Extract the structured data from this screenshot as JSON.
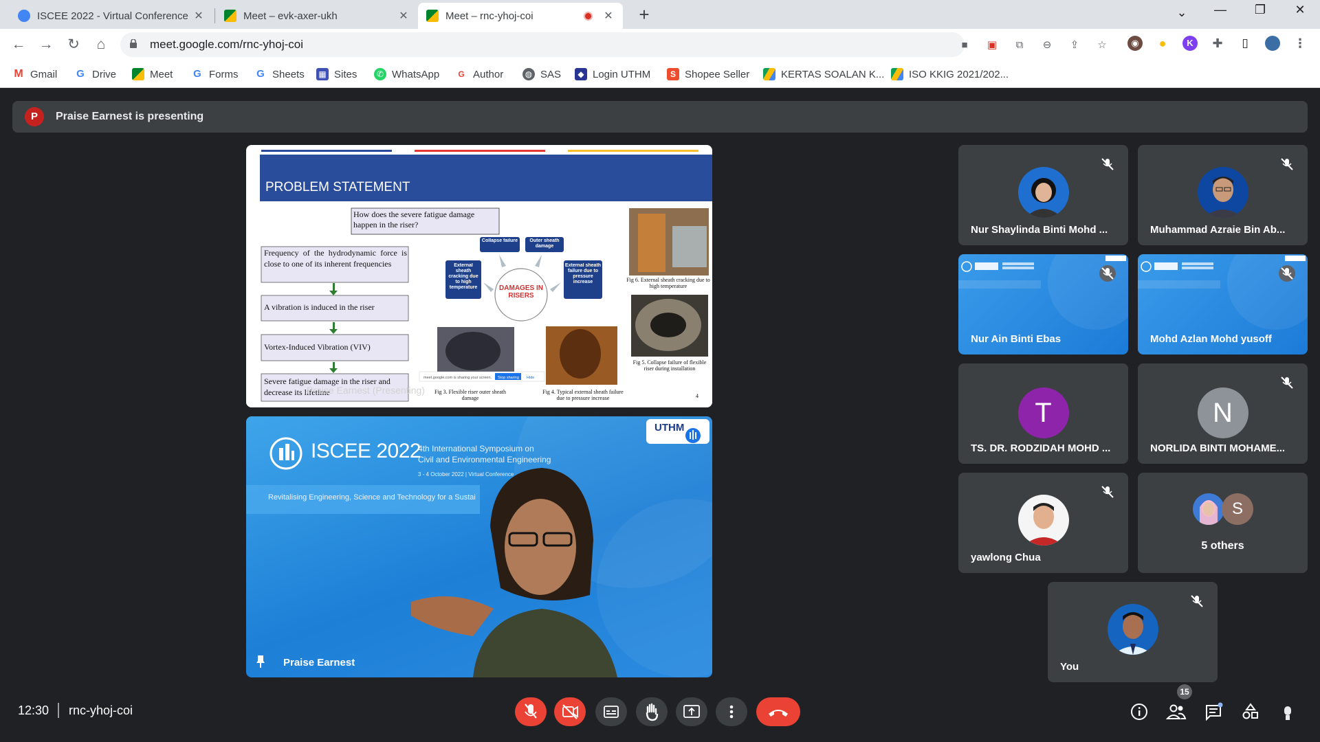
{
  "browser": {
    "tabs": [
      {
        "title": "ISCEE 2022 - Virtual Conference",
        "active": false
      },
      {
        "title": "Meet – evk-axer-ukh",
        "active": false
      },
      {
        "title": "Meet – rnc-yhoj-coi",
        "active": true
      }
    ],
    "url": "meet.google.com/rnc-yhoj-coi",
    "profile_initial": "K",
    "bookmarks": [
      "Gmail",
      "Drive",
      "Meet",
      "Forms",
      "Sheets",
      "Sites",
      "WhatsApp",
      "Author",
      "SAS",
      "Login UTHM",
      "Shopee Seller",
      "KERTAS SOALAN K...",
      "ISO KKIG 2021/202..."
    ]
  },
  "meet": {
    "presenter_initial": "P",
    "presenting_text": "Praise Earnest is presenting",
    "slide": {
      "title": "PROBLEM STATEMENT",
      "question": "How does the severe fatigue damage happen in the riser?",
      "steps": [
        "Frequency of the hydrodynamic force is close to one of its inherent frequencies",
        "A vibration is induced in the riser",
        "Vortex-Induced Vibration (VIV)",
        "Severe fatigue damage in the riser and decrease its lifetime"
      ],
      "center_label": "DAMAGES IN RISERS",
      "causes": [
        "Collapse failure",
        "Outer sheath damage",
        "External sheath cracking due to high temperature",
        "External sheath failure due to pressure increase"
      ],
      "captions": {
        "fig6": "Fig 6. External sheath cracking due to high temperature",
        "fig5": "Fig 5. Collapse failure of flexible riser during installation",
        "fig4": "Fig 4. Typical external sheath failure due to pressure increase",
        "fig3": "Fig 3. Flexible riser outer sheath damage"
      },
      "page_number": "4",
      "overlay_name": "Praise Earnest (Presenting)",
      "share_notice": "meet.google.com is sharing your screen.",
      "stop_sharing": "Stop sharing",
      "hide": "Hide"
    },
    "camera": {
      "brand": "ISCEE 2022",
      "symposium_line1": "4th International Symposium on",
      "symposium_line2": "Civil and Environmental Engineering",
      "dates": "3 - 4 October 2022  |  Virtual Conference",
      "tagline": "Revitalising Engineering, Science and Technology for a Sustai",
      "logo": "UTHM",
      "name": "Praise Earnest"
    },
    "participants": [
      {
        "name": "Nur Shaylinda Binti Mohd ...",
        "type": "photo",
        "muted": true
      },
      {
        "name": "Muhammad Azraie Bin Ab...",
        "type": "photo",
        "muted": true
      },
      {
        "name": "Nur Ain Binti Ebas",
        "type": "banner",
        "muted": true
      },
      {
        "name": "Mohd Azlan Mohd yusoff",
        "type": "banner",
        "muted": true
      },
      {
        "name": "TS. DR. RODZIDAH MOHD ...",
        "type": "initial",
        "initial": "T",
        "color": "#8e24aa",
        "muted": false
      },
      {
        "name": "NORLIDA BINTI MOHAME...",
        "type": "initial",
        "initial": "N",
        "color": "#8d9399",
        "muted": true
      },
      {
        "name": "yawlong Chua",
        "type": "photo",
        "muted": true
      }
    ],
    "others": {
      "label": "5 others",
      "initial": "S"
    },
    "self": {
      "label": "You"
    },
    "bottom": {
      "time": "12:30",
      "code": "rnc-yhoj-coi",
      "people_count": "15"
    },
    "colors": {
      "background": "#202124",
      "tile": "#3c4043",
      "danger": "#ea4335",
      "accent": "#1a73e8"
    }
  }
}
